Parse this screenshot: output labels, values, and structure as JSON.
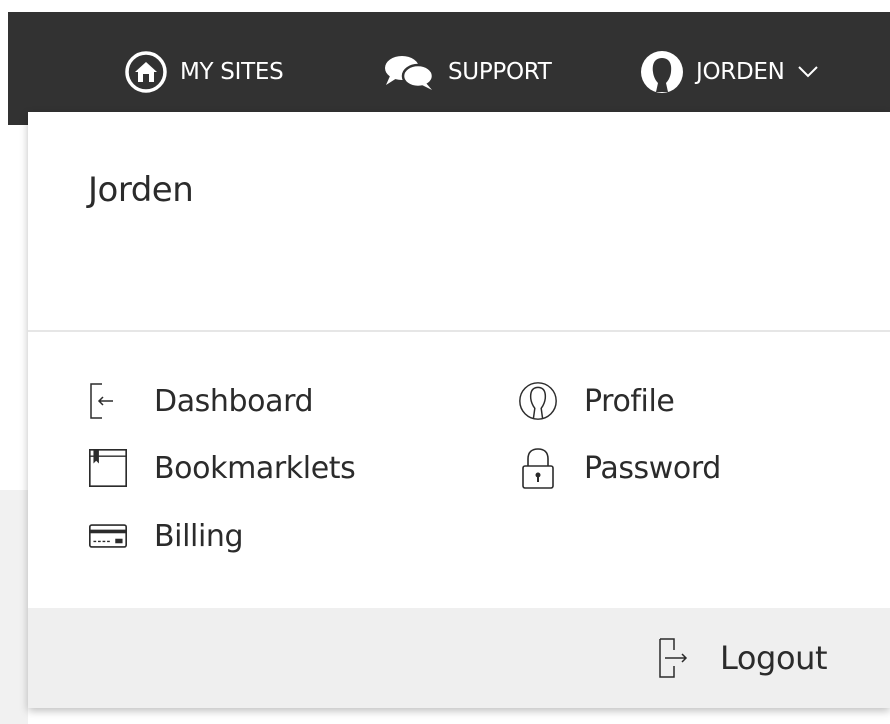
{
  "nav": {
    "my_sites_label": "MY SITES",
    "support_label": "SUPPORT",
    "user_label": "JORDEN",
    "icons": {
      "my_sites": "home-icon",
      "support": "chat-bubbles-icon",
      "user": "user-silhouette-icon",
      "dropdown": "chevron-down-icon"
    }
  },
  "dropdown": {
    "display_name": "Jorden",
    "links": {
      "dashboard": "Dashboard",
      "bookmarklets": "Bookmarklets",
      "billing": "Billing",
      "profile": "Profile",
      "password": "Password"
    },
    "logout_label": "Logout"
  },
  "colors": {
    "topbar": "#323232",
    "text": "#2b2b2b",
    "footer": "#efefef"
  }
}
